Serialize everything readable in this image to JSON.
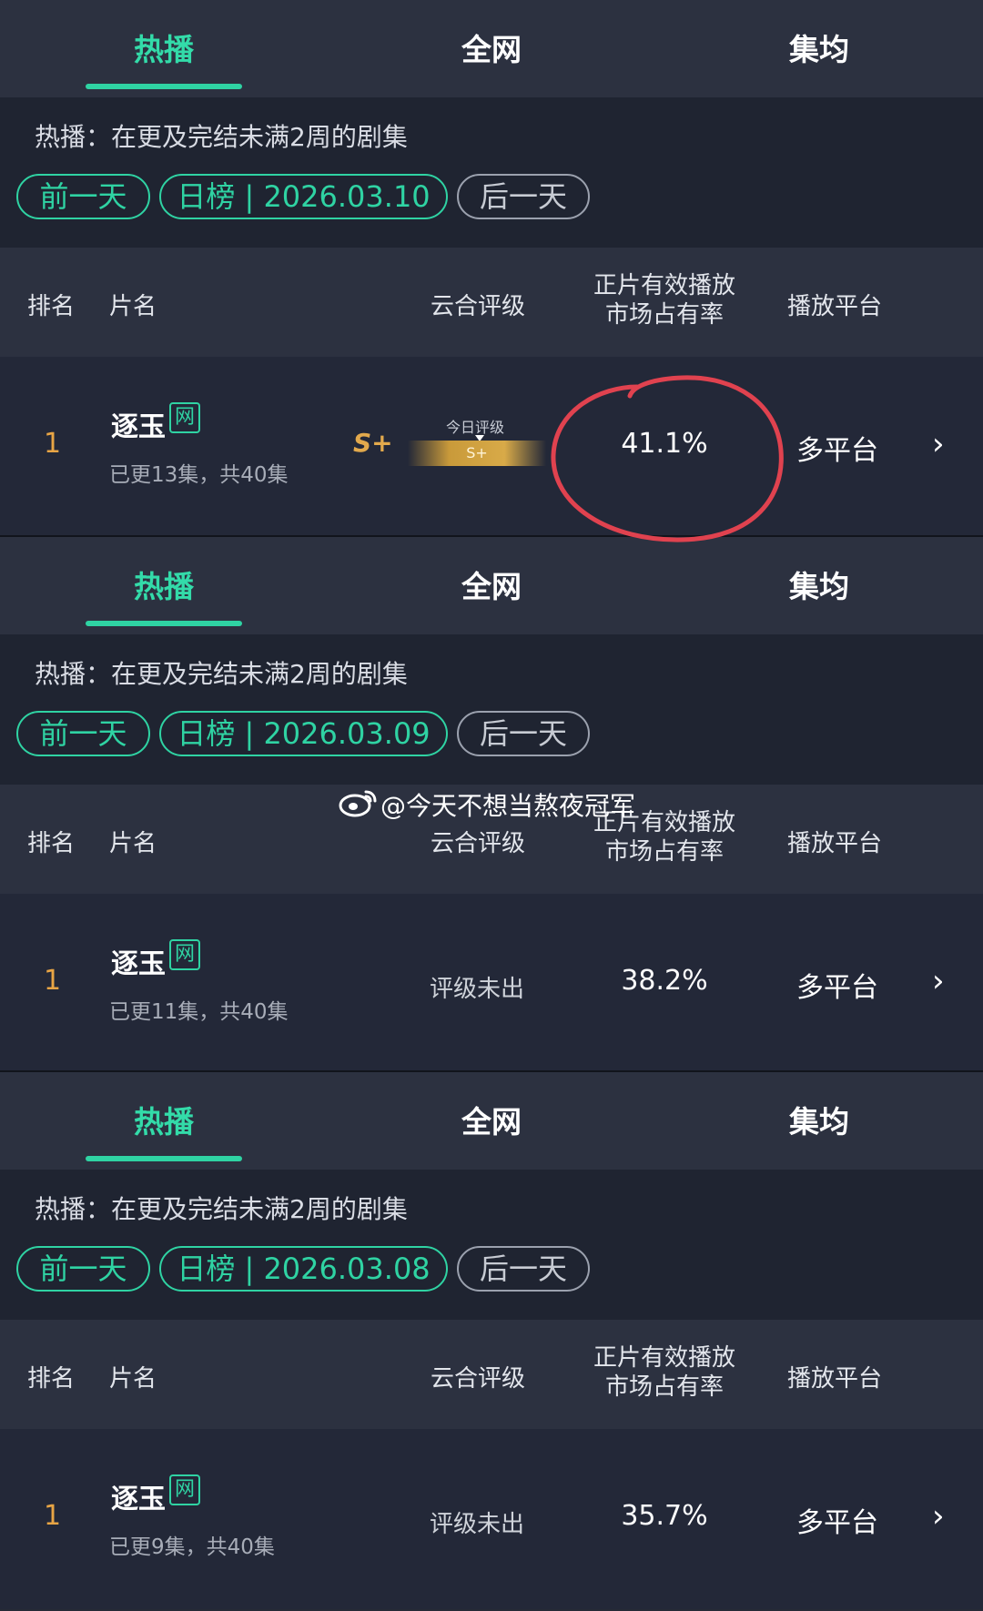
{
  "tabs": [
    "热播",
    "全网",
    "集均"
  ],
  "filter_description": "热播：在更及完结未满2周的剧集",
  "buttons": {
    "prev_day": "前一天",
    "next_day": "后一天"
  },
  "columns": {
    "rank": "排名",
    "title": "片名",
    "rating": "云合评级",
    "share_line1": "正片有效播放",
    "share_line2": "市场占有率",
    "platform": "播放平台"
  },
  "panels": [
    {
      "date_label": "日榜 | 2026.03.10",
      "row": {
        "rank": "1",
        "title": "逐玉",
        "badge": "网",
        "episodes": "已更13集，共40集",
        "rating_grade": "S+",
        "today_rating_label": "今日评级",
        "today_rating_value": "S+",
        "share": "41.1%",
        "platform": "多平台"
      }
    },
    {
      "date_label": "日榜 | 2026.03.09",
      "row": {
        "rank": "1",
        "title": "逐玉",
        "badge": "网",
        "episodes": "已更11集，共40集",
        "rating_text": "评级未出",
        "share": "38.2%",
        "platform": "多平台"
      }
    },
    {
      "date_label": "日榜 | 2026.03.08",
      "row": {
        "rank": "1",
        "title": "逐玉",
        "badge": "网",
        "episodes": "已更9集，共40集",
        "rating_text": "评级未出",
        "share": "35.7%",
        "platform": "多平台"
      }
    }
  ],
  "watermark": "@今天不想当熬夜冠军",
  "colors": {
    "accent": "#2fd3a3",
    "rank": "#e8a545",
    "gold": "#d8aa48",
    "annotation_red": "#e0424f"
  },
  "icons": [
    "chevron-right-icon",
    "weibo-icon"
  ]
}
